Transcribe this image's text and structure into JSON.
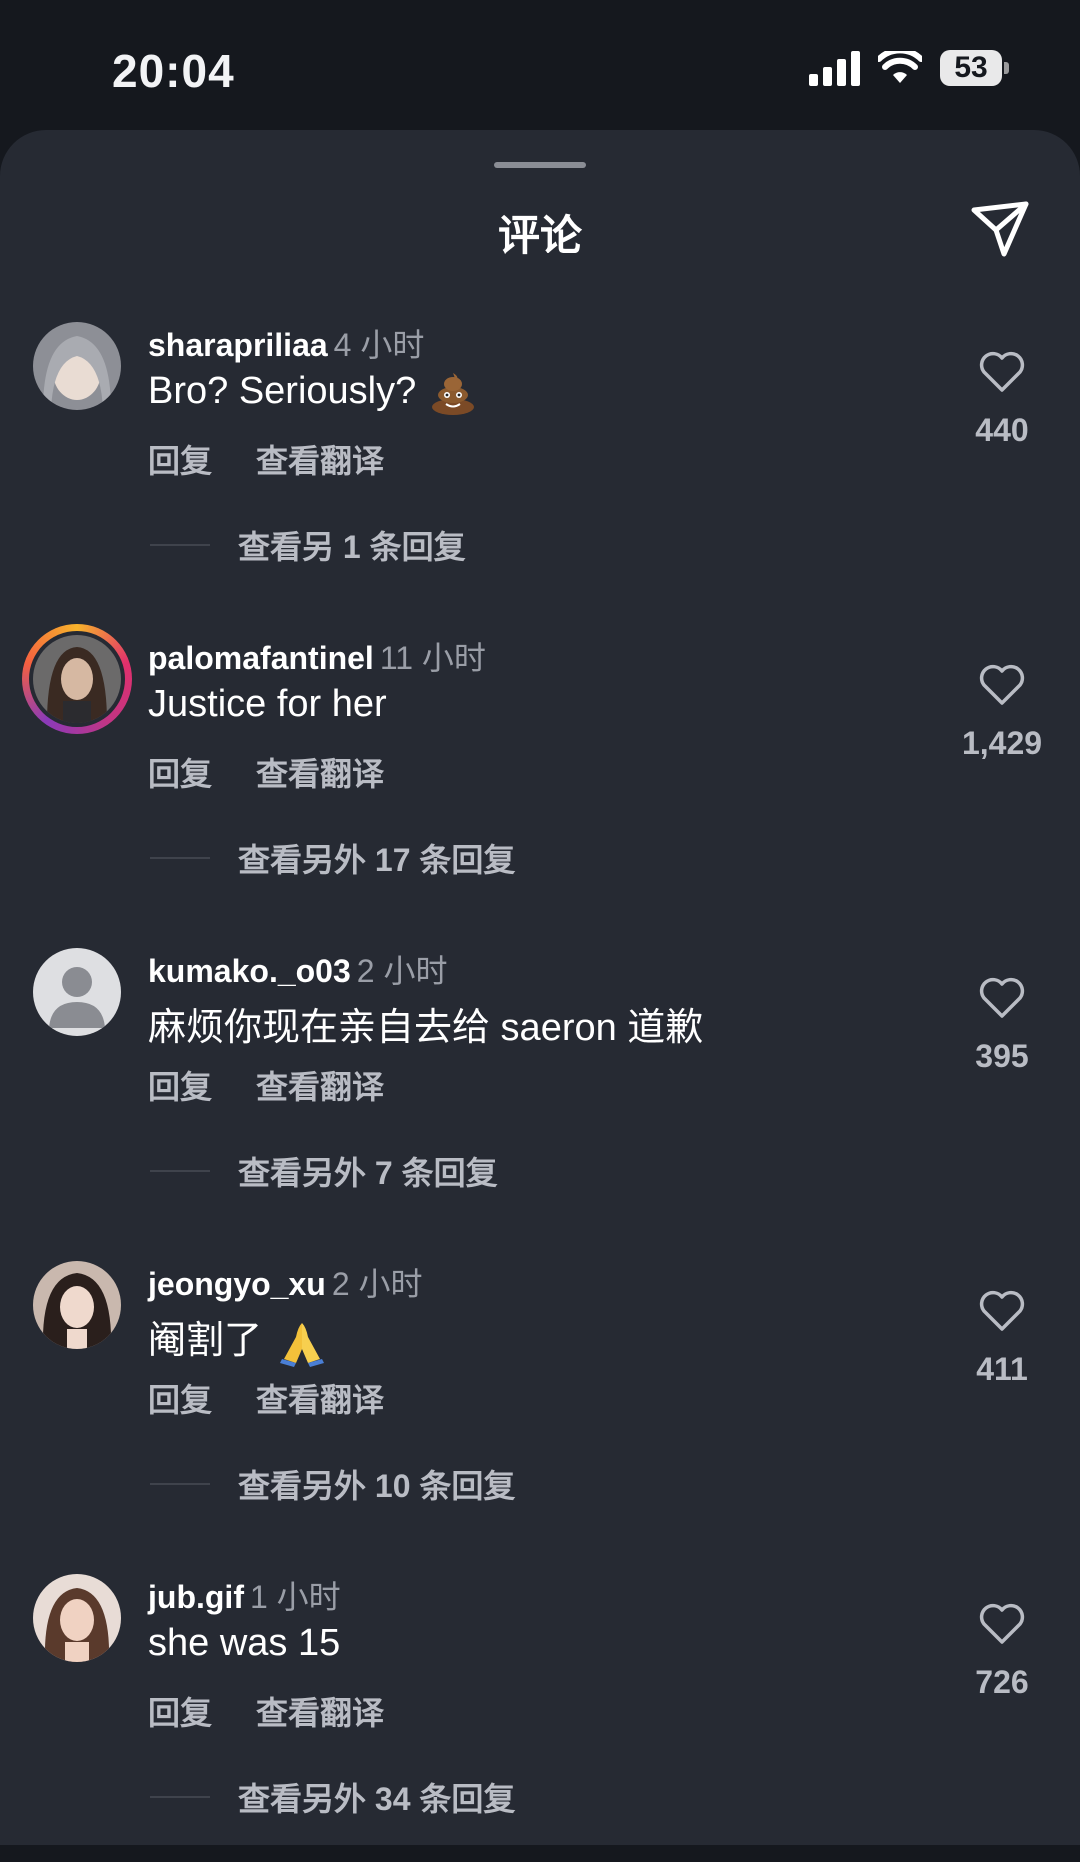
{
  "status_bar": {
    "time": "20:04",
    "battery": "53"
  },
  "header": {
    "title": "评论"
  },
  "actions": {
    "reply": "回复",
    "translate": "查看翻译"
  },
  "comments": [
    {
      "username": "sharapriliaa",
      "time": "4 小时",
      "text": "Bro? Seriously?",
      "emoji": "poo-emoji",
      "likes": "440",
      "more_replies": "查看另 1 条回复"
    },
    {
      "username": "palomafantinel",
      "time": "11 小时",
      "text": "Justice for her",
      "likes": "1,429",
      "more_replies": "查看另外 17 条回复",
      "story_ring": true
    },
    {
      "username": "kumako._o03",
      "time": "2 小时",
      "text": "麻烦你现在亲自去给 saeron 道歉",
      "likes": "395",
      "more_replies": "查看另外 7 条回复",
      "default_avatar": true
    },
    {
      "username": "jeongyo_xu",
      "time": "2 小时",
      "text": "阉割了",
      "emoji": "folded-hands-emoji",
      "likes": "411",
      "more_replies": "查看另外 10 条回复"
    },
    {
      "username": "jub.gif",
      "time": "1 小时",
      "text": "she was 15",
      "likes": "726",
      "more_replies": "查看另外 34 条回复"
    }
  ],
  "colors": {
    "background": "#15181e",
    "sheet": "#262a33",
    "secondary_text": "#b9bcc4"
  }
}
